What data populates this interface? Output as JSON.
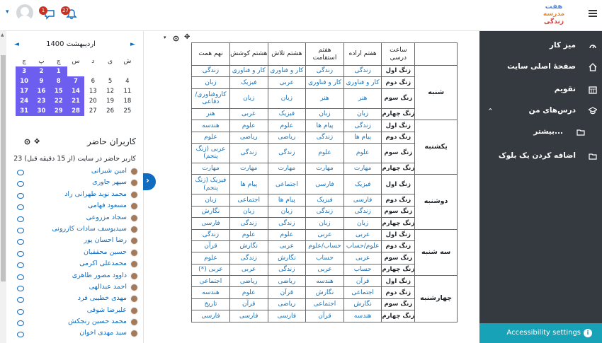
{
  "topbar": {
    "message_count": "1",
    "notification_count": "27",
    "logo_line1": "هفت",
    "logo_line2": "مدرسه",
    "logo_line3": "زندگی"
  },
  "calendar": {
    "title": "اردیبهشت 1400",
    "weekdays": [
      "ش",
      "ی",
      "د",
      "س",
      "چ",
      "پ",
      "ج"
    ],
    "weeks": [
      [
        "",
        "",
        "",
        "",
        "",
        "",
        "1",
        "2",
        "3"
      ],
      [
        "4",
        "5",
        "6",
        "7",
        "8",
        "9",
        "10"
      ],
      [
        "11",
        "12",
        "13",
        "14",
        "15",
        "16",
        "17"
      ],
      [
        "18",
        "19",
        "20",
        "21",
        "22",
        "23",
        "24"
      ],
      [
        "25",
        "26",
        "27",
        "28",
        "29",
        "30",
        "31"
      ]
    ],
    "highlight_color": "#6e5ef0"
  },
  "online": {
    "title": "کاربران حاضر",
    "summary": "23 کاربر حاضر در سایت (از 15 دقیقه قبل)",
    "users": [
      "امین شیرانی",
      "سپهر جاوری",
      "محمد نوید طهرانی راد",
      "مسعود فهامی",
      "سجاد مزروعی",
      "سیدیوسف سادات کازرونی",
      "رضا احسان پور",
      "حسین محققیان",
      "محمدعلی اکرمی",
      "داوود مصور طاهری",
      "احمد عبدالهی",
      "مهدی خطیبی فرد",
      "علیرضا شوقی",
      "محمد حسین رنجکش",
      "سید مهدی اخوان"
    ]
  },
  "schedule": {
    "headers": [
      "ساعت درسی",
      "هفتم اراده",
      "هفتم استقامت",
      "هشتم تلاش",
      "هشتم کوشش",
      "نهم همت"
    ],
    "days": [
      {
        "name": "شنبه",
        "rows": [
          [
            "زنگ اول",
            "زندگی",
            "زندگی",
            "کار و فناوری",
            "کار و فناوری",
            "زندگی"
          ],
          [
            "زنگ دوم",
            "کار و فناوری",
            "کار و فناوری",
            "عربی",
            "فیزیک",
            "زبان"
          ],
          [
            "زنگ سوم",
            "هنر",
            "هنر",
            "زبان",
            "زبان",
            "کاروفناوری/ دفاعی"
          ],
          [
            "زنگ چهارم",
            "زبان",
            "زبان",
            "فیزیک",
            "عربی",
            "هنر"
          ]
        ]
      },
      {
        "name": "یکشنبه",
        "rows": [
          [
            "زنگ اول",
            "زندگی",
            "پیام ها",
            "علوم",
            "علوم",
            "هندسه"
          ],
          [
            "زنگ دوم",
            "پیام ها",
            "زندگی",
            "ریاضی",
            "ریاضی",
            "علوم"
          ],
          [
            "زنگ سوم",
            "علوم",
            "علوم",
            "زندگی",
            "زندگی",
            "عربی (زنگ پنجم)"
          ],
          [
            "زنگ چهارم",
            "مهارت",
            "مهارت",
            "مهارت",
            "مهارت",
            "مهارت"
          ]
        ]
      },
      {
        "name": "دوشنبه",
        "rows": [
          [
            "زنگ اول",
            "فیزیک",
            "فارسی",
            "اجتماعی",
            "پیام ها",
            "فیزیک (زنگ پنجم)"
          ],
          [
            "زنگ دوم",
            "فارسی",
            "فیزیک",
            "پیام ها",
            "اجتماعی",
            "زبان"
          ],
          [
            "زنگ سوم",
            "زندگی",
            "زندگی",
            "زبان",
            "زبان",
            "نگارش"
          ],
          [
            "زنگ چهارم",
            "زبان",
            "زبان",
            "زندگی",
            "زندگی",
            "فارسی"
          ]
        ]
      },
      {
        "name": "سه شنبه",
        "rows": [
          [
            "زنگ اول",
            "عربی",
            "عربی",
            "علوم",
            "علوم",
            "زندگی"
          ],
          [
            "زنگ دوم",
            "علوم/حساب",
            "حساب/علوم",
            "عربی",
            "نگارش",
            "قرآن"
          ],
          [
            "زنگ سوم",
            "عربی",
            "حساب",
            "نگارش",
            "زندگی",
            "علوم"
          ],
          [
            "زنگ چهارم",
            "حساب",
            "عربی",
            "زندگی",
            "عربی",
            "عربی (*)"
          ]
        ]
      },
      {
        "name": "چهارشنبه",
        "rows": [
          [
            "زنگ اول",
            "قرآن",
            "هندسه",
            "ریاضی",
            "ریاضی",
            "اجتماعی"
          ],
          [
            "زنگ دوم",
            "اجتماعی",
            "نگارش",
            "قرآن",
            "علوم",
            "هندسه"
          ],
          [
            "زنگ سوم",
            "نگارش",
            "اجتماعی",
            "ریاضی",
            "قرآن",
            "تاریخ"
          ],
          [
            "زنگ چهارم",
            "هندسه",
            "قرآن",
            "فارسی",
            "فارسی",
            "فارسی"
          ]
        ]
      }
    ]
  },
  "sidebar": {
    "items": [
      {
        "label": "میز کار",
        "icon": "dashboard-icon"
      },
      {
        "label": "صفحهٔ اصلی سایت",
        "icon": "home-icon"
      },
      {
        "label": "تقویم",
        "icon": "calendar-icon"
      },
      {
        "label": "درس‌های من",
        "icon": "graduation-cap-icon"
      },
      {
        "label": "بیشتر...",
        "icon": "folder-icon"
      },
      {
        "label": "اضافه کردن یک بلوک",
        "icon": "folder-icon"
      }
    ],
    "accessibility_label": "Accessibility settings"
  }
}
